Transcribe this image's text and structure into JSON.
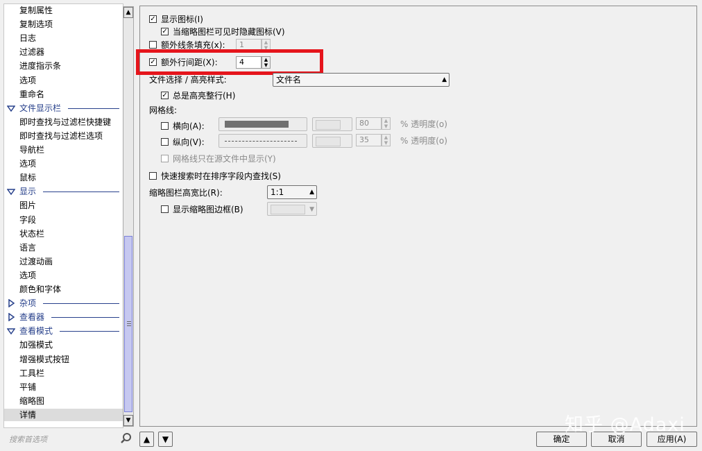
{
  "sidebar": {
    "items": [
      {
        "label": "复制属性",
        "type": "item"
      },
      {
        "label": "复制选项",
        "type": "item"
      },
      {
        "label": "日志",
        "type": "item"
      },
      {
        "label": "过滤器",
        "type": "item"
      },
      {
        "label": "进度指示条",
        "type": "item"
      },
      {
        "label": "选项",
        "type": "item"
      },
      {
        "label": "重命名",
        "type": "item"
      },
      {
        "label": "文件显示栏",
        "type": "group",
        "expanded": true
      },
      {
        "label": "即时查找与过滤栏快捷键",
        "type": "item"
      },
      {
        "label": "即时查找与过滤栏选项",
        "type": "item"
      },
      {
        "label": "导航栏",
        "type": "item"
      },
      {
        "label": "选项",
        "type": "item"
      },
      {
        "label": "鼠标",
        "type": "item"
      },
      {
        "label": "显示",
        "type": "group",
        "expanded": true
      },
      {
        "label": "图片",
        "type": "item"
      },
      {
        "label": "字段",
        "type": "item"
      },
      {
        "label": "状态栏",
        "type": "item"
      },
      {
        "label": "语言",
        "type": "item"
      },
      {
        "label": "过渡动画",
        "type": "item"
      },
      {
        "label": "选项",
        "type": "item"
      },
      {
        "label": "颜色和字体",
        "type": "item"
      },
      {
        "label": "杂项",
        "type": "group",
        "expanded": false
      },
      {
        "label": "查看器",
        "type": "group",
        "expanded": false
      },
      {
        "label": "查看模式",
        "type": "group",
        "expanded": true
      },
      {
        "label": "加强模式",
        "type": "item"
      },
      {
        "label": "增强模式按钮",
        "type": "item"
      },
      {
        "label": "工具栏",
        "type": "item"
      },
      {
        "label": "平铺",
        "type": "item"
      },
      {
        "label": "缩略图",
        "type": "item"
      },
      {
        "label": "详情",
        "type": "item",
        "selected": true
      }
    ],
    "search_placeholder": "搜索首选项"
  },
  "settings": {
    "show_icons": {
      "label": "显示图标(I)",
      "checked": true
    },
    "hide_icons_when_thumb": {
      "label": "当缩略图栏可见时隐藏图标(V)",
      "checked": true
    },
    "extra_line_fill": {
      "label": "额外线条填充(x):",
      "checked": false,
      "value": "1"
    },
    "extra_row_spacing": {
      "label": "额外行间距(X):",
      "checked": true,
      "value": "4"
    },
    "file_select_style": {
      "label": "文件选择 / 高亮样式:",
      "value": "文件名"
    },
    "always_highlight_row": {
      "label": "总是高亮整行(H)",
      "checked": true
    },
    "gridlines": {
      "label": "网格线:",
      "horizontal": {
        "label": "横向(A):",
        "checked": false,
        "opacity": "80",
        "opacity_label": "% 透明度(o)"
      },
      "vertical": {
        "label": "纵向(V):",
        "checked": false,
        "opacity": "35",
        "opacity_label": "% 透明度(o)"
      },
      "source_only": {
        "label": "网格线只在源文件中显示(Y)",
        "checked": false
      }
    },
    "quick_search_sorted": {
      "label": "快速搜索时在排序字段内查找(S)",
      "checked": false
    },
    "thumb_ratio": {
      "label": "缩略图栏高宽比(R):",
      "value": "1:1"
    },
    "show_thumb_border": {
      "label": "显示缩略图边框(B)",
      "checked": false
    }
  },
  "footer": {
    "ok": "确定",
    "cancel": "取消",
    "apply": "应用(A)"
  },
  "watermark": "知乎 @Adaxi",
  "colors": {
    "highlight_box": "#e5151c",
    "group_text": "#27408b"
  }
}
